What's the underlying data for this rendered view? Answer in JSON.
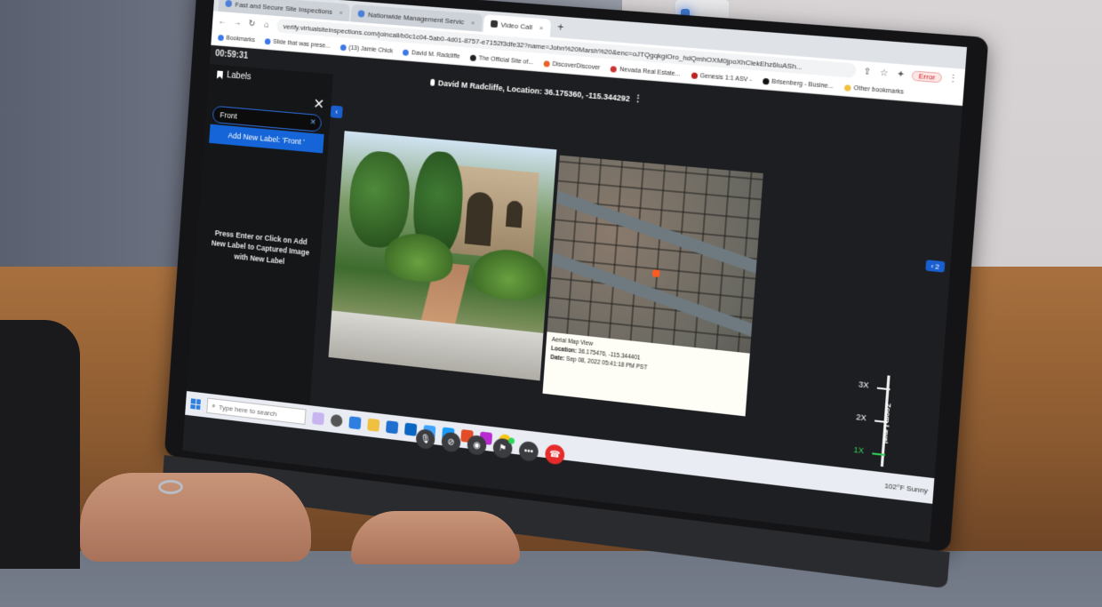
{
  "browser": {
    "tabs": [
      {
        "label": "Fast and Secure Site Inspections",
        "active": false
      },
      {
        "label": "Nationwide Management Servic",
        "active": false
      },
      {
        "label": "Video Call",
        "active": true
      }
    ],
    "url": "verify.virtualsiteinspections.com/joincall/b0c1c04-5ab0-4d01-8757-e7152f3dfe32?name=John%20Marsh%20&enc=oJTQgqkgiOro_hdQmhOXM0jpoXhClekEhz6luASh...",
    "profile_label": "Error",
    "bookmarks": [
      "Bookmarks",
      "Slide that was prese...",
      "(13) Jamie Chick",
      "David M. Radcliffe",
      "The Official Site of...",
      "DiscoverDiscover",
      "Nevada Real Estate...",
      "Genesis 1:1 ASV -",
      "Brisenberg - Busine...",
      "Other bookmarks"
    ]
  },
  "call": {
    "timer": "00:59:31",
    "caller": "David M Radcliffe, Location: 36.175360, -115.344292"
  },
  "labels_panel": {
    "title": "Labels",
    "input_value": "Front",
    "add_button": "Add New Label: 'Front '",
    "hint": "Press Enter or Click on Add New Label to Captured Image with New Label"
  },
  "aerial": {
    "caption_title": "Aerial Map View",
    "location_label": "Location:",
    "location_value": "36.175476, -115.344401",
    "date_label": "Date:",
    "date_value": "Sep 08, 2022 05:41:18 PM PST"
  },
  "right_toggle": "2",
  "zoom": {
    "title": "Zoom Level",
    "levels": [
      "3X",
      "2X",
      "1X"
    ],
    "active_level": "1X"
  },
  "taskbar": {
    "search_placeholder": "Type here to search",
    "weather": "102°F  Sunny"
  },
  "icons": [
    "bookmark-icon",
    "close-icon",
    "mic-icon",
    "video-off-icon",
    "camera-icon",
    "label-icon",
    "more-icon",
    "end-call-icon",
    "windows-icon",
    "search-icon"
  ],
  "colors": {
    "accent": "#1565d8",
    "end_call": "#e62b2b",
    "zoom_active": "#2fd05a"
  }
}
